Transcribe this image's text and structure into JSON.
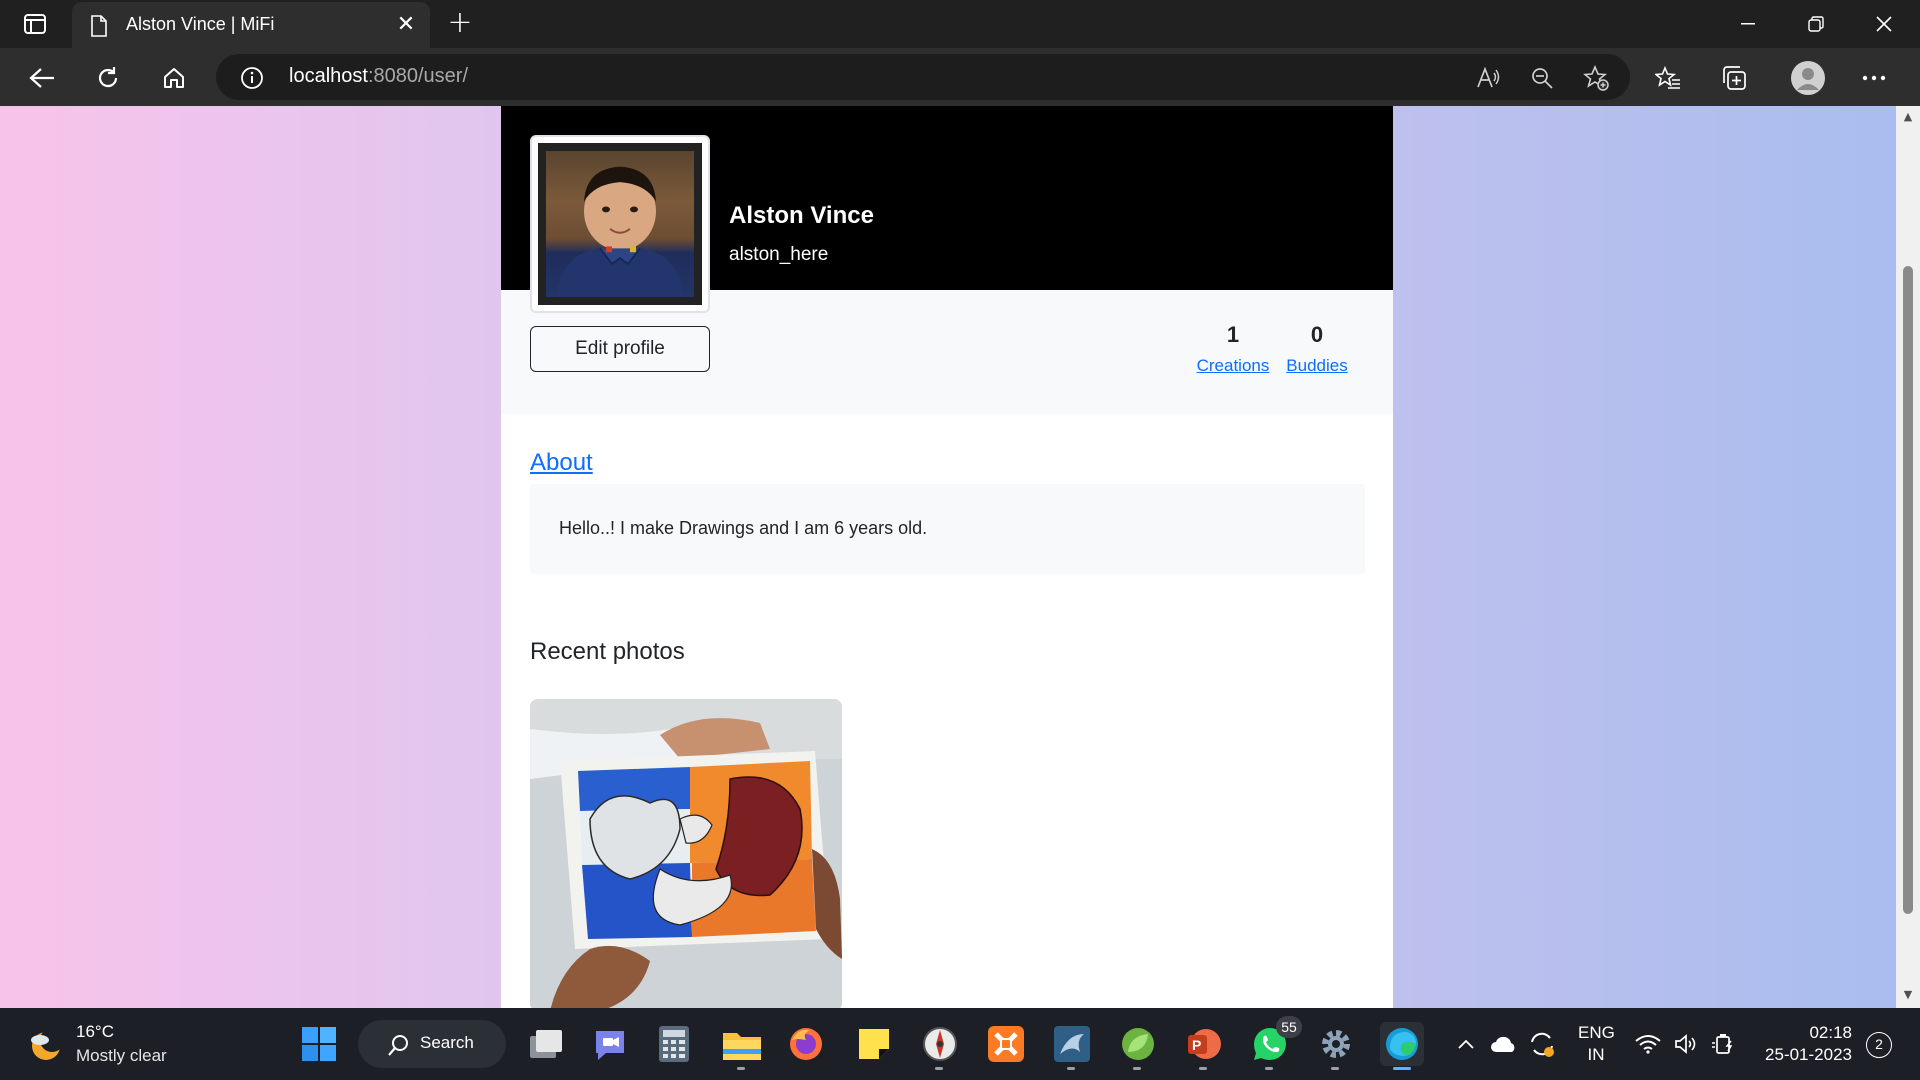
{
  "browser": {
    "tab_title": "Alston Vince | MiFi",
    "url_host": "localhost",
    "url_rest": ":8080/user/"
  },
  "profile": {
    "name": "Alston Vince",
    "username": "alston_here",
    "edit_label": "Edit profile",
    "creations_count": "1",
    "creations_label": "Creations",
    "buddies_count": "0",
    "buddies_label": "Buddies",
    "about_label": "About",
    "about_text": "Hello..! I make Drawings and I am 6 years old.",
    "recent_heading": "Recent photos"
  },
  "taskbar": {
    "weather_temp": "16°C",
    "weather_desc": "Mostly clear",
    "search_label": "Search",
    "whatsapp_badge": "55",
    "lang_line1": "ENG",
    "lang_line2": "IN",
    "time": "02:18",
    "date": "25-01-2023",
    "notifications": "2"
  },
  "colors": {
    "link": "#0d6efd",
    "header_bg": "#000000",
    "taskbar_bg": "#1c1f26"
  }
}
